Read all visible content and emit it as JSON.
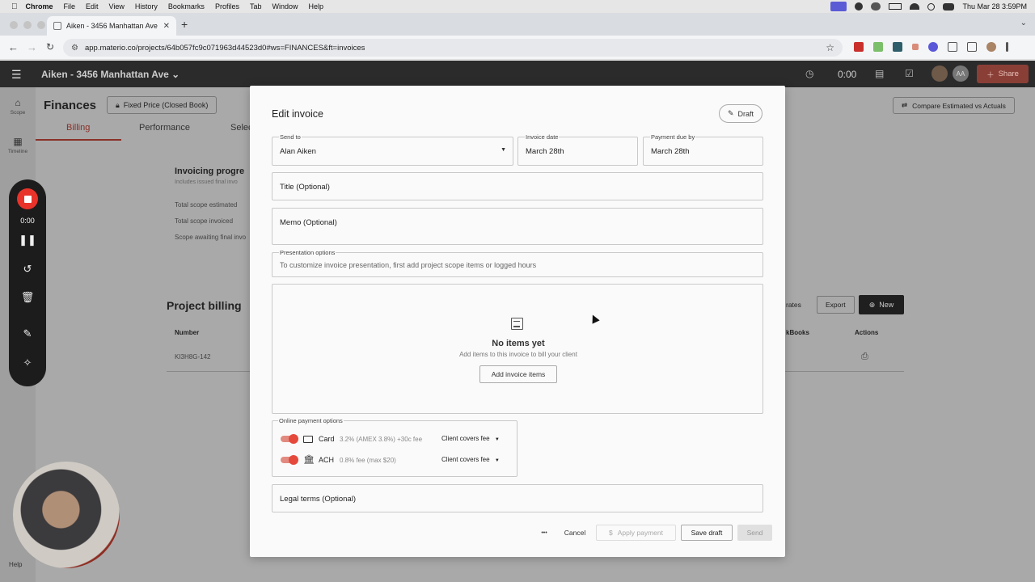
{
  "menubar": {
    "app": "Chrome",
    "items": [
      "File",
      "Edit",
      "View",
      "History",
      "Bookmarks",
      "Profiles",
      "Tab",
      "Window",
      "Help"
    ],
    "clock": "Thu Mar 28  3:59PM"
  },
  "browser": {
    "tab_title": "Aiken - 3456 Manhattan Ave",
    "url": "app.materio.co/projects/64b057fc9c071963d44523d0#ws=FINANCES&ft=invoices"
  },
  "app": {
    "project_title": "Aiken - 3456 Manhattan Ave",
    "timer": "0:00",
    "avatar_initials": "AA",
    "share_label": "Share",
    "sidebar": [
      {
        "label": "Scope",
        "icon": "home-icon"
      },
      {
        "label": "Timeline",
        "icon": "calendar-icon"
      }
    ],
    "help_label": "Help"
  },
  "background": {
    "page_title": "Finances",
    "contract_chip": "Fixed Price (Closed Book)",
    "tabs": [
      "Billing",
      "Performance",
      "Selec"
    ],
    "compare_button": "Compare Estimated vs Actuals",
    "progress_heading": "Invoicing progre",
    "progress_sub": "Includes issued final invo",
    "progress_rows": [
      "Total scope estimated",
      "Total scope invoiced",
      "Scope awaiting final invo"
    ],
    "billing_heading": "Project billing",
    "col_number": "Number",
    "col_quickbooks": "kBooks",
    "col_actions": "Actions",
    "row_number": "KI3H8G-142",
    "rates_btn": "rates",
    "export_btn": "Export",
    "new_btn": "New"
  },
  "recorder": {
    "time": "0:00"
  },
  "modal": {
    "title": "Edit invoice",
    "status": "Draft",
    "send_to": {
      "label": "Send to",
      "value": "Alan Aiken"
    },
    "invoice_date": {
      "label": "Invoice date",
      "value": "March 28th"
    },
    "payment_due": {
      "label": "Payment due by",
      "value": "March 28th"
    },
    "title_placeholder": "Title (Optional)",
    "memo_placeholder": "Memo (Optional)",
    "presentation": {
      "label": "Presentation options",
      "hint": "To customize invoice presentation, first add project scope items or logged hours"
    },
    "empty_state": {
      "title": "No items yet",
      "subtitle": "Add items to this invoice to bill your client",
      "button": "Add invoice items"
    },
    "online_payment": {
      "label": "Online payment options",
      "methods": [
        {
          "name": "Card",
          "fee": "3.2% (AMEX 3.8%) +30c fee",
          "option": "Client covers fee"
        },
        {
          "name": "ACH",
          "fee": "0.8% fee (max $20)",
          "option": "Client covers fee"
        }
      ]
    },
    "legal_placeholder": "Legal terms (Optional)",
    "footer": {
      "more": "•••",
      "cancel": "Cancel",
      "apply_payment": "Apply payment",
      "save_draft": "Save draft",
      "send": "Send"
    }
  }
}
